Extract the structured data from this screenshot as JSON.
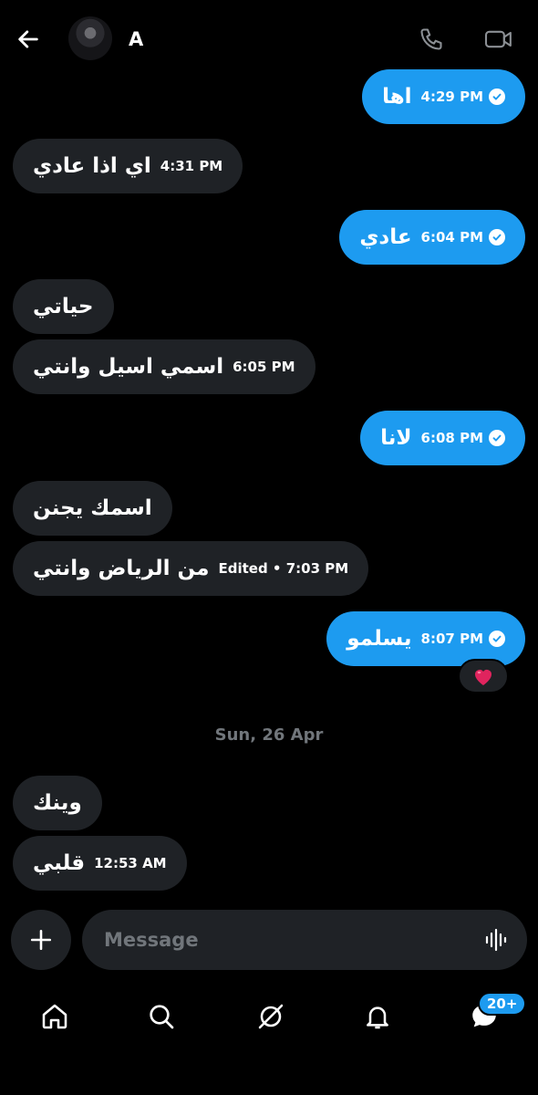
{
  "header": {
    "contact_name": "A"
  },
  "messages": [
    {
      "id": "m1",
      "text": "اها",
      "time": "4:29 PM"
    },
    {
      "id": "m2",
      "text": "اي اذا عادي",
      "time": "4:31 PM"
    },
    {
      "id": "m3",
      "text": "عادي",
      "time": "6:04 PM"
    },
    {
      "id": "m4",
      "text": "حياتي",
      "time": ""
    },
    {
      "id": "m5",
      "text": "اسمي اسيل وانتي",
      "time": "6:05 PM"
    },
    {
      "id": "m6",
      "text": "لانا",
      "time": "6:08 PM"
    },
    {
      "id": "m7",
      "text": "اسمك يجنن",
      "time": ""
    },
    {
      "id": "m8",
      "text": "من الرياض وانتي",
      "time": "Edited • 7:03 PM"
    },
    {
      "id": "m9",
      "text": "يسلمو",
      "time": "8:07 PM"
    },
    {
      "id": "m10",
      "text": "وينك",
      "time": ""
    },
    {
      "id": "m11",
      "text": "قلبي",
      "time": "12:53 AM"
    }
  ],
  "reaction": {
    "emoji": "❤️"
  },
  "date_separator": "Sun, 26 Apr",
  "composer": {
    "placeholder": "Message"
  },
  "nav": {
    "items": [
      "home-icon",
      "search-icon",
      "grok-icon",
      "notifications-icon",
      "messages-icon"
    ],
    "messages_badge": "20+"
  },
  "colors": {
    "background": "#000000",
    "outgoing_bubble": "#1d9bf0",
    "incoming_bubble": "#1f2226",
    "muted_text": "#71767b"
  }
}
